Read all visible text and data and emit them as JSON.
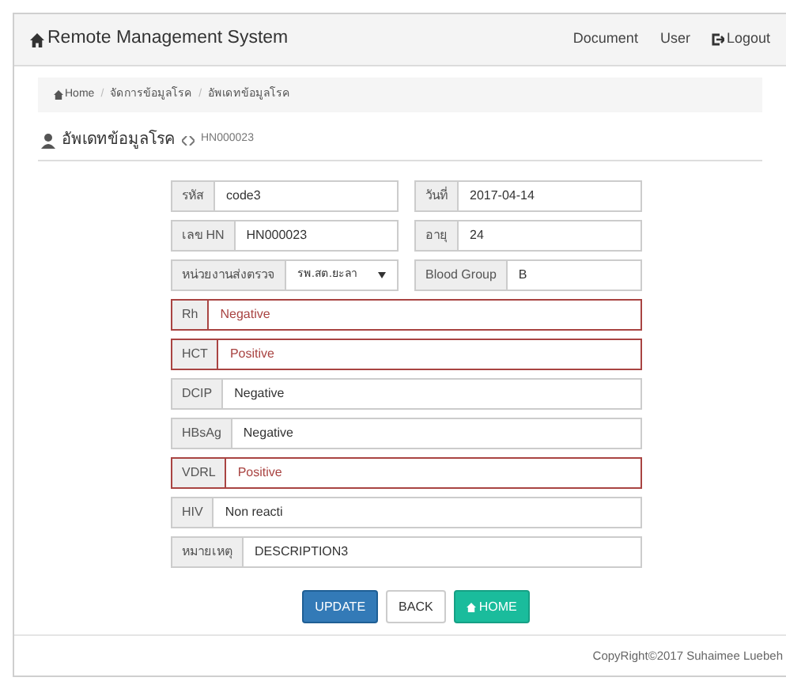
{
  "navbar": {
    "brand": "Remote Management System",
    "links": [
      {
        "label": "Document",
        "kind": "plain"
      },
      {
        "label": "User",
        "kind": "plain"
      },
      {
        "label": "Logout",
        "kind": "logout"
      }
    ]
  },
  "breadcrumb": {
    "separator": "/",
    "items": [
      "Home",
      "จัดการข้อมูลโรค",
      "อัพเดทข้อมูลโรค"
    ]
  },
  "panel": {
    "title": "อัพเดทข้อมูลโรค",
    "record": "HN000023"
  },
  "form_rows": [
    [
      {
        "label": "รหัส",
        "value": "code3",
        "kind": "text",
        "alert": false
      },
      {
        "label": "วันที่",
        "value": "2017-04-14",
        "kind": "text",
        "alert": false
      }
    ],
    [
      {
        "label": "เลข HN",
        "value": "HN000023",
        "kind": "text",
        "alert": false
      },
      {
        "label": "อายุ",
        "value": "24",
        "kind": "text",
        "alert": false
      }
    ],
    [
      {
        "label": "หน่วยงานส่งตรวจ",
        "value": "รพ.สต.ยะลา",
        "kind": "select",
        "alert": false
      },
      {
        "label": "Blood Group",
        "value": "B",
        "kind": "text",
        "alert": false
      }
    ],
    [
      {
        "label": "Rh",
        "value": "Negative",
        "kind": "text",
        "alert": true
      }
    ],
    [
      {
        "label": "HCT",
        "value": "Positive",
        "kind": "text",
        "alert": true
      }
    ],
    [
      {
        "label": "DCIP",
        "value": "Negative",
        "kind": "text",
        "alert": false
      }
    ],
    [
      {
        "label": "HBsAg",
        "value": "Negative",
        "kind": "text",
        "alert": false
      }
    ],
    [
      {
        "label": "VDRL",
        "value": "Positive",
        "kind": "text",
        "alert": true
      }
    ],
    [
      {
        "label": "HIV",
        "value": "Non reacti",
        "kind": "text",
        "alert": false
      }
    ],
    [
      {
        "label": "หมายเหตุ",
        "value": "DESCRIPTION3",
        "kind": "text",
        "alert": false
      }
    ]
  ],
  "buttons": [
    {
      "label": "UPDATE",
      "kind": "primary"
    },
    {
      "label": "BACK",
      "kind": "default"
    },
    {
      "label": "HOME",
      "kind": "home"
    }
  ],
  "footer": "CopyRight©2017 Suhaimee Luebeh"
}
